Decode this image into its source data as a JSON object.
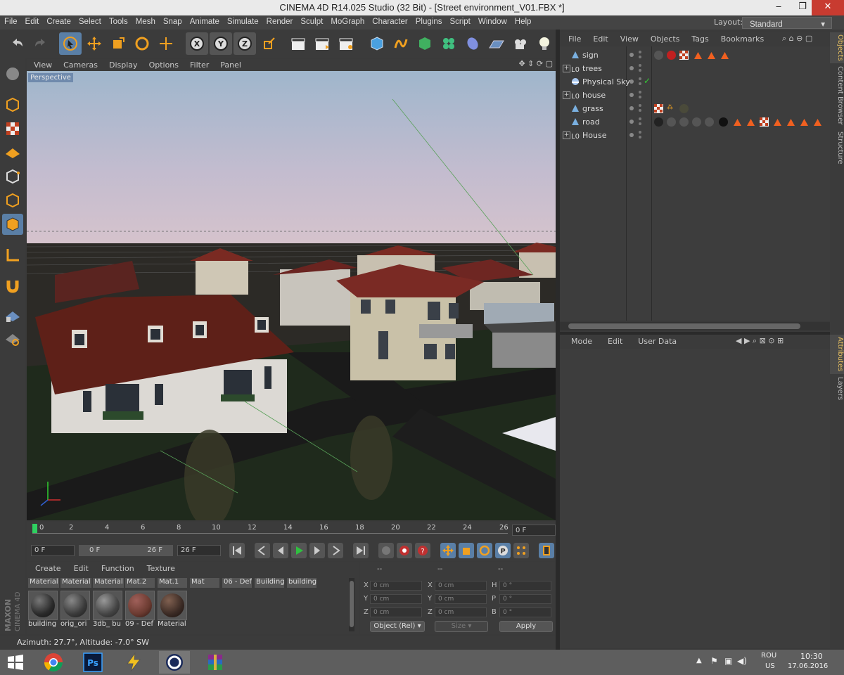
{
  "window": {
    "title": "CINEMA 4D R14.025 Studio (32 Bit) - [Street environment_V01.FBX *]",
    "minimize": "‒",
    "maximize": "❐",
    "close": "✕"
  },
  "menubar": {
    "items": [
      "File",
      "Edit",
      "Create",
      "Select",
      "Tools",
      "Mesh",
      "Snap",
      "Animate",
      "Simulate",
      "Render",
      "Sculpt",
      "MoGraph",
      "Character",
      "Plugins",
      "Script",
      "Window",
      "Help"
    ],
    "layout_label": "Layout:",
    "layout_value": "Standard"
  },
  "viewport": {
    "menu": [
      "View",
      "Cameras",
      "Display",
      "Options",
      "Filter",
      "Panel"
    ],
    "label": "Perspective"
  },
  "timeline": {
    "ticks": [
      "0",
      "2",
      "4",
      "6",
      "8",
      "10",
      "12",
      "14",
      "16",
      "18",
      "20",
      "22",
      "24",
      "26"
    ],
    "end_field": "0 F"
  },
  "anim": {
    "current": "0 F",
    "range_start": "0 F",
    "range_end": "26 F",
    "max": "26 F"
  },
  "materials": {
    "menu": [
      "Create",
      "Edit",
      "Function",
      "Texture"
    ],
    "tabs": [
      "Material",
      "Material",
      "Material",
      "Mat.2",
      "Mat.1",
      "Mat",
      "06 - Def",
      "Building",
      "building"
    ],
    "balls": [
      {
        "label": "building",
        "color": "#2a2a2a"
      },
      {
        "label": "orig_ori",
        "color": "#3a3a3a"
      },
      {
        "label": "3db_ bu",
        "color": "#444444"
      },
      {
        "label": "09 - Def",
        "color": "#6a3a30"
      },
      {
        "label": "Material",
        "color": "#3a2a24"
      }
    ],
    "logo_text": "MAXON CINEMA 4D"
  },
  "coords": {
    "headers": [
      "--",
      "--",
      "--"
    ],
    "rows": [
      {
        "a": "X",
        "av": "0 cm",
        "b": "X",
        "bv": "0 cm",
        "c": "H",
        "cv": "0 °"
      },
      {
        "a": "Y",
        "av": "0 cm",
        "b": "Y",
        "bv": "0 cm",
        "c": "P",
        "cv": "0 °"
      },
      {
        "a": "Z",
        "av": "0 cm",
        "b": "Z",
        "bv": "0 cm",
        "c": "B",
        "cv": "0 °"
      }
    ],
    "mode": "Object (Rel)",
    "size": "Size",
    "apply": "Apply"
  },
  "status": {
    "text": "Azimuth: 27.7°, Altitude: -7.0°  SW"
  },
  "object_manager": {
    "menu": [
      "File",
      "Edit",
      "View",
      "Objects",
      "Tags",
      "Bookmarks"
    ],
    "objects": [
      {
        "name": "sign",
        "icon": "polygon-icon",
        "expand": false
      },
      {
        "name": "trees",
        "icon": "null-icon",
        "expand": true
      },
      {
        "name": "Physical Sky",
        "icon": "sky-icon",
        "expand": false
      },
      {
        "name": "house",
        "icon": "null-icon",
        "expand": true
      },
      {
        "name": "grass",
        "icon": "polygon-icon",
        "expand": false
      },
      {
        "name": "road",
        "icon": "polygon-icon",
        "expand": false
      },
      {
        "name": "House",
        "icon": "null-icon",
        "expand": true
      }
    ]
  },
  "attributes": {
    "menu": [
      "Mode",
      "Edit",
      "User Data"
    ]
  },
  "side_tabs": [
    "Objects",
    "Content Browser",
    "Structure",
    "Attributes",
    "Layers"
  ],
  "taskbar": {
    "apps": [
      "windows-start",
      "chrome",
      "photoshop",
      "winamp",
      "cinema4d",
      "winrar"
    ],
    "lang": "ROU",
    "lang2": "US",
    "time": "10:30",
    "date": "17.06.2016"
  },
  "colors": {
    "accent": "#5a7fa6",
    "orange": "#f0a020",
    "panel": "#3b3b3b"
  }
}
